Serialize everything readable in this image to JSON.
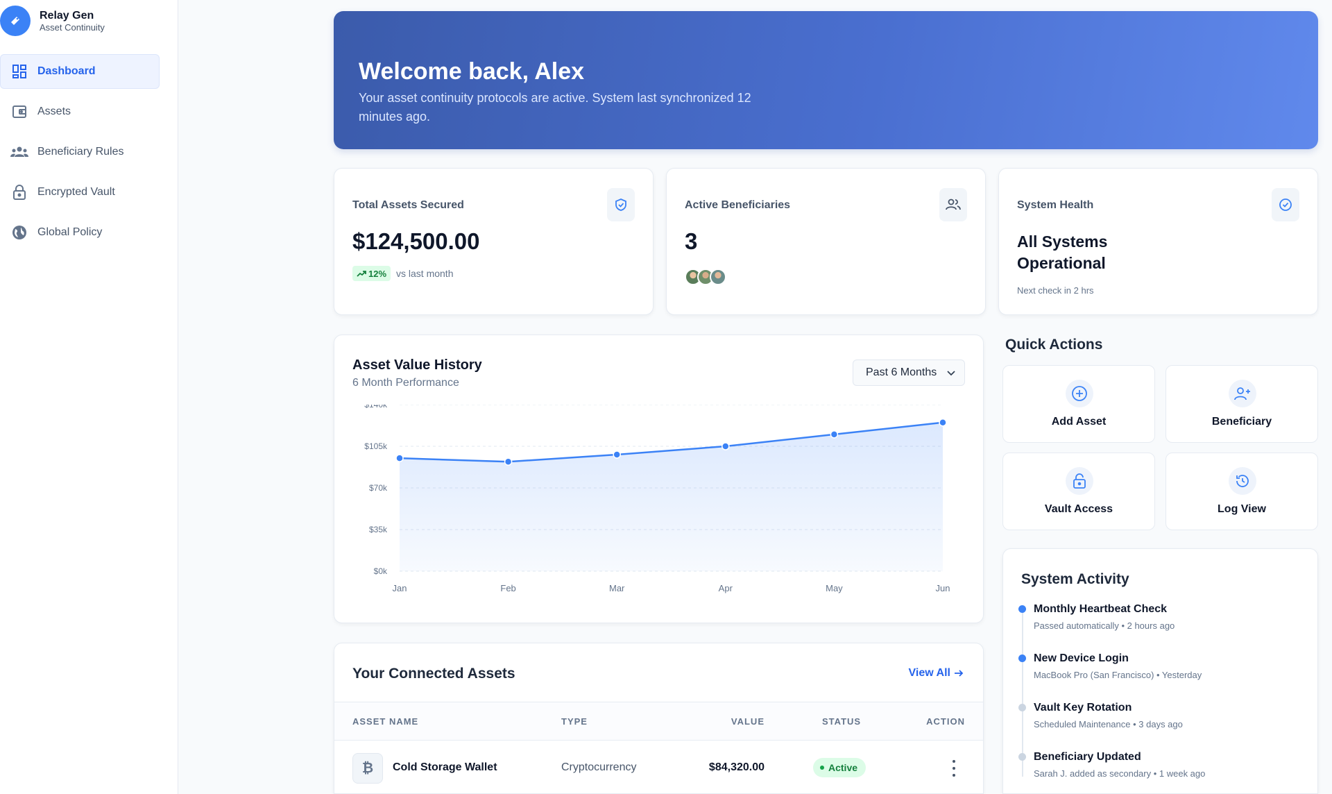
{
  "app": {
    "name": "Relay Gen",
    "subtitle": "Asset Continuity"
  },
  "sidebar": {
    "items": [
      {
        "label": "Dashboard",
        "icon": "dashboard-icon",
        "active": true
      },
      {
        "label": "Assets",
        "icon": "wallet-icon"
      },
      {
        "label": "Beneficiary Rules",
        "icon": "group-icon"
      },
      {
        "label": "Encrypted Vault",
        "icon": "lock-icon"
      },
      {
        "label": "Global Policy",
        "icon": "globe-icon"
      }
    ]
  },
  "hero": {
    "title": "Welcome back, Alex",
    "subtitle": "Your asset continuity protocols are active. System last synchronized 12 minutes ago."
  },
  "stats": {
    "assets": {
      "label": "Total Assets Secured",
      "value": "$124,500.00",
      "change": "12%",
      "change_note": "vs last month",
      "icon": "shield-check-icon"
    },
    "beneficiaries": {
      "label": "Active Beneficiaries",
      "value": "3",
      "icon": "users-icon"
    },
    "health": {
      "label": "System Health",
      "value": "All Systems Operational",
      "note": "Next check in 2 hrs",
      "icon": "check-circle-icon"
    }
  },
  "chart": {
    "title": "Asset Value History",
    "subtitle": "6 Month Performance",
    "range_selected": "Past 6 Months"
  },
  "chart_data": {
    "type": "area",
    "categories": [
      "Jan",
      "Feb",
      "Mar",
      "Apr",
      "May",
      "Jun"
    ],
    "values": [
      95000,
      92000,
      98000,
      105000,
      115000,
      125000
    ],
    "y_ticks": [
      "$0k",
      "$35k",
      "$70k",
      "$105k",
      "$140k"
    ],
    "ylim": [
      0,
      140000
    ],
    "grid": true,
    "color": "#3b82f6"
  },
  "quick_actions": {
    "title": "Quick Actions",
    "items": [
      {
        "label": "Add Asset",
        "icon": "plus-circle-icon"
      },
      {
        "label": "Beneficiary",
        "icon": "user-plus-icon"
      },
      {
        "label": "Vault Access",
        "icon": "unlock-icon"
      },
      {
        "label": "Log View",
        "icon": "history-icon"
      }
    ]
  },
  "activity": {
    "title": "System Activity",
    "items": [
      {
        "name": "Monthly Heartbeat Check",
        "desc": "Passed automatically • 2 hours ago",
        "color": "#3b82f6"
      },
      {
        "name": "New Device Login",
        "desc": "MacBook Pro (San Francisco) • Yesterday",
        "color": "#3b82f6"
      },
      {
        "name": "Vault Key Rotation",
        "desc": "Scheduled Maintenance • 3 days ago",
        "color": "#cbd5e1"
      },
      {
        "name": "Beneficiary Updated",
        "desc": "Sarah J. added as secondary • 1 week ago",
        "color": "#cbd5e1"
      }
    ]
  },
  "assets_table": {
    "title": "Your Connected Assets",
    "view_all": "View All",
    "columns": [
      "ASSET NAME",
      "TYPE",
      "VALUE",
      "STATUS",
      "ACTION"
    ],
    "rows": [
      {
        "icon": "bitcoin-icon",
        "icon_glyph": "₿",
        "name": "Cold Storage Wallet",
        "type": "Cryptocurrency",
        "value": "$84,320.00",
        "status": "Active"
      }
    ]
  },
  "colors": {
    "accent": "#3b82f6",
    "success": "#15803d",
    "hero_start": "#3b5bab",
    "hero_end": "#6089ec"
  }
}
